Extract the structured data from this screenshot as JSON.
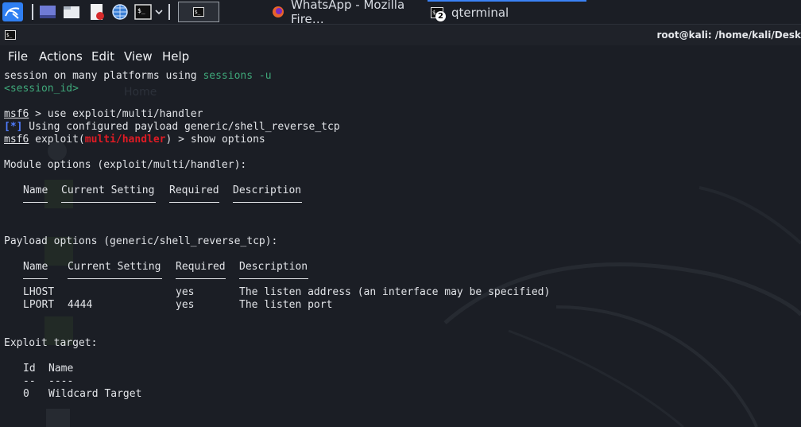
{
  "taskbar": {
    "whatsapp_title": "WhatsApp - Mozilla Fire…",
    "qterminal_title": "qterminal",
    "qterminal_badge": "2",
    "terminal_button_glyph": "$_"
  },
  "window": {
    "title": "root@kali: /home/kali/Desk"
  },
  "menu": {
    "file": "File",
    "actions": "Actions",
    "edit": "Edit",
    "view": "View",
    "help": "Help"
  },
  "desktop_ghost": {
    "home": "Home"
  },
  "terminal": {
    "l1_a": "session on many platforms using ",
    "l1_b": "sessions -u",
    "l2": "<session_id>",
    "prompt": "msf6",
    "l4_rest": " > use exploit/multi/handler",
    "l5_tag": "[*]",
    "l5_rest": " Using configured payload generic/shell_reverse_tcp",
    "l6_mid": " exploit(",
    "l6_module": "multi/handler",
    "l6_rest": ") > show options",
    "module_options_title": "Module options (exploit/multi/handler):",
    "module_headers": [
      "Name",
      "Current Setting",
      "Required",
      "Description"
    ],
    "payload_options_title": "Payload options (generic/shell_reverse_tcp):",
    "payload_headers": [
      "Name",
      "Current Setting",
      "Required",
      "Description"
    ],
    "payload_rows": [
      {
        "name": "LHOST",
        "setting": "",
        "required": "yes",
        "description": "The listen address (an interface may be specified)"
      },
      {
        "name": "LPORT",
        "setting": "4444",
        "required": "yes",
        "description": "The listen port"
      }
    ],
    "exploit_target_title": "Exploit target:",
    "target_headers": [
      "Id",
      "Name"
    ],
    "target_dashes": [
      "--",
      "----"
    ],
    "target_rows": [
      {
        "id": "0",
        "name": "Wildcard Target"
      }
    ]
  },
  "colors": {
    "accent": "#3b82f6",
    "prompt_red": "#e01b24",
    "info_blue": "#4f7cff",
    "cyan": "#3fa87a"
  }
}
